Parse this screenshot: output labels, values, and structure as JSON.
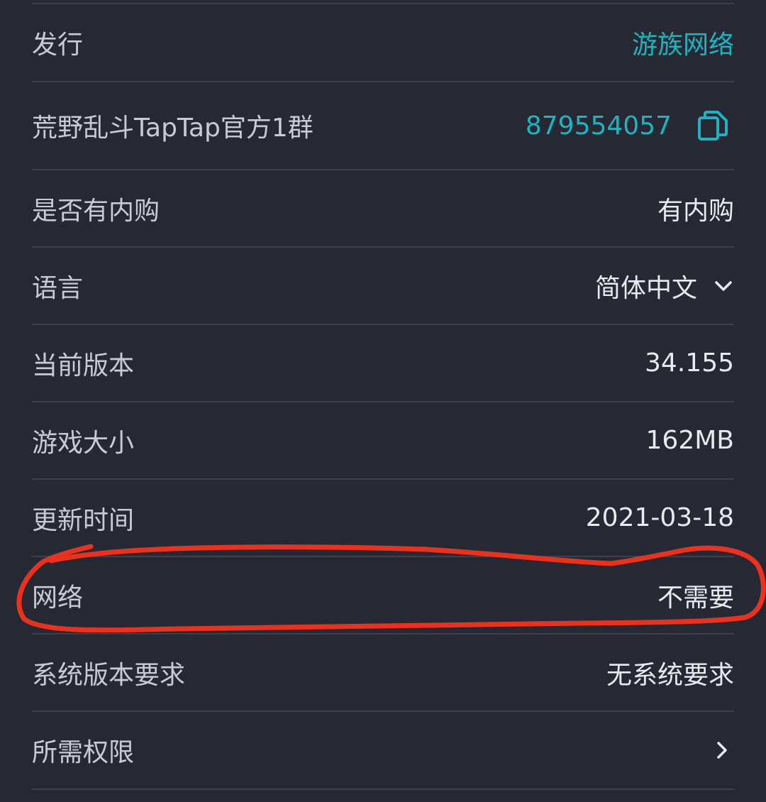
{
  "rows": [
    {
      "label": "发行",
      "value": "游族网络"
    },
    {
      "label": "荒野乱斗TapTap官方1群",
      "value": "879554057"
    },
    {
      "label": "是否有内购",
      "value": "有内购"
    },
    {
      "label": "语言",
      "value": "简体中文"
    },
    {
      "label": "当前版本",
      "value": "34.155"
    },
    {
      "label": "游戏大小",
      "value": "162MB"
    },
    {
      "label": "更新时间",
      "value": "2021-03-18"
    },
    {
      "label": "网络",
      "value": "不需要"
    },
    {
      "label": "系统版本要求",
      "value": "无系统要求"
    },
    {
      "label": "所需权限",
      "value": ""
    }
  ],
  "icons": {
    "copy": "copy-icon",
    "dropdown": "chevron-down-icon",
    "disclosure": "chevron-right-icon"
  },
  "colors": {
    "background": "#262833",
    "divider": "#3b3e4b",
    "label_text": "#c9cbd3",
    "value_text": "#e9eaee",
    "accent": "#1fb3bf",
    "annotation": "#e8321e"
  }
}
